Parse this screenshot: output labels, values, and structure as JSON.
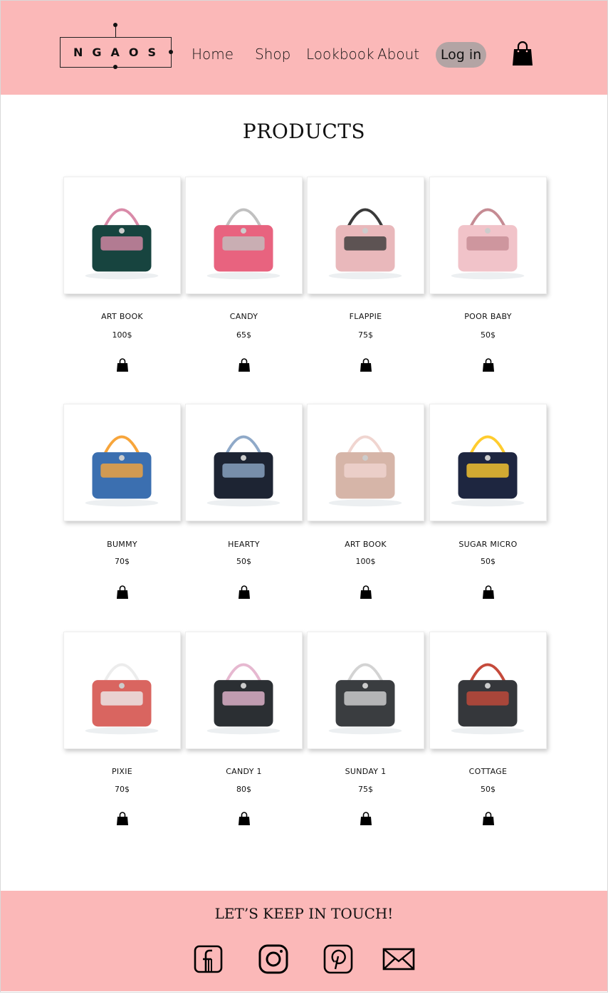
{
  "brand": {
    "logo_text": "NGAOS"
  },
  "nav": {
    "home": "Home",
    "shop": "Shop",
    "lookbook": "Lookbook",
    "about": "About",
    "login": "Log in"
  },
  "main": {
    "title": "PRODUCTS"
  },
  "products": [
    {
      "name": "ART BOOK",
      "price": "100$",
      "icon": "tote-bag"
    },
    {
      "name": "CANDY",
      "price": "65$",
      "icon": "crossbody-bag"
    },
    {
      "name": "FLAPPIE",
      "price": "75$",
      "icon": "flap-bag"
    },
    {
      "name": "POOR BABY",
      "price": "50$",
      "icon": "pouch"
    },
    {
      "name": "BUMMY",
      "price": "70$",
      "icon": "backpack"
    },
    {
      "name": "HEARTY",
      "price": "50$",
      "icon": "heart-wristlet"
    },
    {
      "name": "ART BOOK",
      "price": "100$",
      "icon": "tote-bag"
    },
    {
      "name": "SUGAR MICRO",
      "price": "50$",
      "icon": "micro-bag"
    },
    {
      "name": "PIXIE",
      "price": "70$",
      "icon": "vanity-case"
    },
    {
      "name": "CANDY 1",
      "price": "80$",
      "icon": "chain-bag"
    },
    {
      "name": "SUNDAY 1",
      "price": "75$",
      "icon": "shoulder-bag"
    },
    {
      "name": "COTTAGE",
      "price": "50$",
      "icon": "square-bag"
    }
  ],
  "footer": {
    "title": "LET’S KEEP IN TOUCH!",
    "social": [
      "facebook-icon",
      "instagram-icon",
      "pinterest-icon",
      "mail-icon"
    ]
  },
  "colors": {
    "header_bg": "#fbb8b8",
    "login_bg": "#b3a4a4",
    "text": "#111111"
  }
}
